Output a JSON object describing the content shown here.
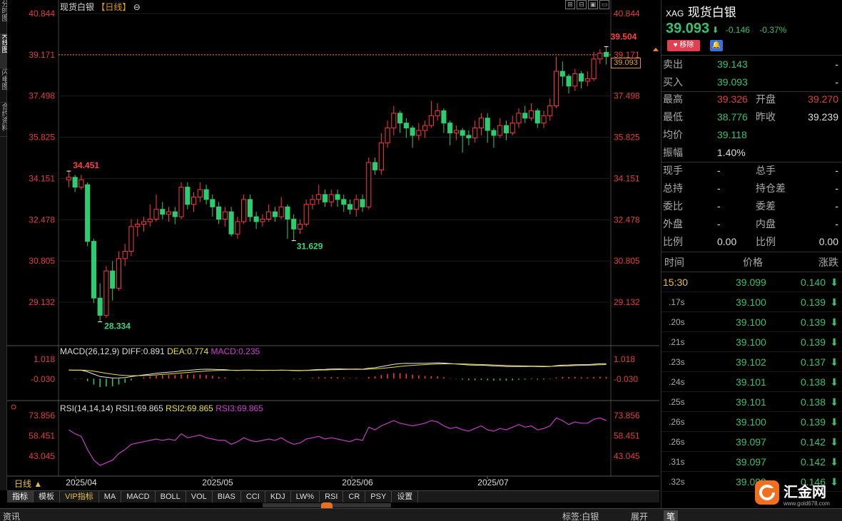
{
  "left_tabs": [
    {
      "label": "分时图",
      "active": false
    },
    {
      "label": "K线图",
      "active": true
    },
    {
      "label": "闪电图",
      "active": false
    },
    {
      "label": "合约资料",
      "active": false
    }
  ],
  "chart_header": {
    "title": "现货白银",
    "period_label": "【日线】",
    "settings_glyph": "⊖"
  },
  "window_icons": [
    "⊞",
    "⊟",
    "▣",
    "▭"
  ],
  "chart_data": {
    "type": "candlestick",
    "y_ticks": [
      "40.844",
      "39.171",
      "37.498",
      "35.825",
      "34.151",
      "32.478",
      "30.805",
      "29.132"
    ],
    "ylim": [
      28.0,
      41.2
    ],
    "x_ticks": [
      "2025/04",
      "2025/05",
      "2025/06",
      "2025/07"
    ],
    "current_price_line": 39.171,
    "current_price_box": "39.093",
    "annotations": [
      {
        "label": "34.451",
        "color": "#ff4040"
      },
      {
        "label": "28.334",
        "color": "#40d080"
      },
      {
        "label": "31.629",
        "color": "#40d080"
      },
      {
        "label": "39.504",
        "color": "#ff4040"
      }
    ],
    "candles": [
      [
        34.1,
        34.2,
        34.45,
        33.8
      ],
      [
        34.2,
        33.8,
        34.3,
        33.6
      ],
      [
        33.8,
        34.1,
        34.3,
        33.7
      ],
      [
        33.9,
        31.6,
        34.0,
        31.4
      ],
      [
        31.6,
        29.3,
        31.7,
        29.1
      ],
      [
        29.3,
        28.6,
        29.9,
        28.33
      ],
      [
        28.6,
        30.4,
        30.6,
        28.5
      ],
      [
        30.4,
        29.7,
        30.8,
        29.2
      ],
      [
        29.7,
        30.9,
        31.2,
        29.6
      ],
      [
        30.9,
        31.2,
        31.5,
        30.6
      ],
      [
        31.2,
        32.2,
        32.5,
        31.0
      ],
      [
        32.2,
        32.3,
        32.5,
        31.8
      ],
      [
        32.3,
        32.4,
        32.6,
        32.0
      ],
      [
        32.4,
        32.5,
        33.1,
        32.2
      ],
      [
        32.5,
        32.9,
        33.5,
        32.4
      ],
      [
        32.9,
        32.7,
        33.2,
        32.5
      ],
      [
        32.7,
        32.8,
        33.0,
        32.4
      ],
      [
        32.8,
        32.6,
        33.0,
        32.3
      ],
      [
        32.6,
        33.8,
        34.0,
        32.5
      ],
      [
        33.8,
        33.1,
        34.0,
        32.9
      ],
      [
        33.1,
        33.4,
        33.6,
        32.8
      ],
      [
        33.4,
        33.7,
        34.0,
        33.2
      ],
      [
        33.7,
        33.3,
        33.9,
        33.1
      ],
      [
        33.3,
        33.0,
        33.5,
        32.6
      ],
      [
        33.0,
        32.5,
        33.2,
        32.3
      ],
      [
        32.5,
        32.8,
        33.0,
        32.2
      ],
      [
        32.8,
        31.9,
        33.0,
        31.8
      ],
      [
        31.9,
        32.4,
        32.6,
        31.7
      ],
      [
        32.4,
        33.3,
        33.5,
        32.3
      ],
      [
        33.3,
        32.6,
        33.5,
        32.4
      ],
      [
        32.6,
        32.4,
        32.8,
        32.1
      ],
      [
        32.4,
        32.5,
        32.7,
        32.2
      ],
      [
        32.5,
        32.8,
        33.1,
        32.4
      ],
      [
        32.8,
        32.6,
        33.0,
        32.4
      ],
      [
        32.6,
        33.0,
        33.4,
        32.5
      ],
      [
        33.0,
        32.5,
        33.1,
        31.7
      ],
      [
        32.5,
        32.1,
        32.7,
        31.63
      ],
      [
        32.1,
        32.3,
        32.5,
        31.9
      ],
      [
        32.3,
        33.1,
        33.3,
        32.2
      ],
      [
        33.1,
        33.3,
        33.5,
        32.9
      ],
      [
        33.3,
        33.5,
        33.9,
        33.1
      ],
      [
        33.5,
        33.2,
        33.7,
        33.0
      ],
      [
        33.2,
        33.5,
        33.7,
        33.0
      ],
      [
        33.5,
        33.3,
        33.7,
        33.0
      ],
      [
        33.3,
        33.1,
        33.5,
        32.8
      ],
      [
        33.1,
        32.9,
        33.3,
        32.7
      ],
      [
        32.9,
        33.3,
        33.5,
        32.6
      ],
      [
        33.3,
        33.0,
        33.5,
        32.8
      ],
      [
        33.0,
        34.8,
        35.0,
        32.9
      ],
      [
        34.8,
        34.5,
        35.0,
        34.3
      ],
      [
        34.5,
        35.6,
        36.0,
        34.3
      ],
      [
        35.6,
        36.2,
        36.5,
        35.4
      ],
      [
        36.2,
        36.8,
        37.1,
        35.9
      ],
      [
        36.8,
        36.4,
        36.9,
        36.0
      ],
      [
        36.4,
        36.2,
        36.6,
        35.8
      ],
      [
        36.2,
        35.9,
        36.3,
        35.4
      ],
      [
        35.9,
        36.1,
        36.4,
        35.7
      ],
      [
        36.1,
        36.3,
        36.5,
        35.8
      ],
      [
        36.3,
        36.7,
        37.3,
        36.2
      ],
      [
        36.7,
        36.9,
        37.2,
        36.5
      ],
      [
        36.9,
        36.4,
        37.0,
        36.0
      ],
      [
        36.4,
        36.0,
        36.5,
        35.5
      ],
      [
        36.0,
        36.1,
        36.3,
        35.7
      ],
      [
        36.1,
        35.9,
        36.2,
        35.2
      ],
      [
        35.9,
        35.8,
        36.1,
        35.5
      ],
      [
        35.8,
        36.2,
        36.5,
        35.6
      ],
      [
        36.2,
        36.6,
        36.8,
        35.9
      ],
      [
        36.6,
        36.1,
        36.8,
        35.6
      ],
      [
        36.1,
        35.9,
        36.2,
        35.4
      ],
      [
        35.9,
        36.3,
        36.6,
        35.8
      ],
      [
        36.3,
        36.0,
        36.5,
        35.7
      ],
      [
        36.0,
        36.4,
        36.7,
        35.9
      ],
      [
        36.4,
        36.8,
        37.0,
        36.2
      ],
      [
        36.8,
        36.6,
        37.1,
        36.4
      ],
      [
        36.6,
        36.9,
        37.2,
        36.5
      ],
      [
        36.9,
        36.4,
        37.0,
        36.2
      ],
      [
        36.4,
        36.7,
        36.9,
        36.2
      ],
      [
        36.7,
        37.1,
        37.4,
        36.5
      ],
      [
        37.1,
        38.5,
        39.1,
        37.0
      ],
      [
        38.5,
        38.3,
        38.9,
        37.9
      ],
      [
        38.3,
        37.9,
        38.4,
        37.6
      ],
      [
        37.9,
        38.4,
        38.6,
        37.7
      ],
      [
        38.4,
        38.1,
        38.5,
        37.8
      ],
      [
        38.1,
        38.2,
        38.5,
        37.9
      ],
      [
        38.2,
        39.0,
        39.3,
        38.1
      ],
      [
        39.0,
        39.24,
        39.4,
        38.8
      ],
      [
        39.27,
        39.1,
        39.5,
        38.78
      ]
    ]
  },
  "macd": {
    "legend_title": "MACD(26,12,9)",
    "diff_label": "DIFF:0.891",
    "dea_label": "DEA:0.774",
    "macd_label": "MACD:0.235",
    "y_ticks": [
      "1.018",
      "-0.030"
    ]
  },
  "rsi": {
    "legend_title": "RSI(14,14,14)",
    "rsi1_label": "RSI1:69.865",
    "rsi2_label": "RSI2:69.865",
    "rsi3_label": "RSI3:69.865",
    "y_ticks": [
      "73.856",
      "58.451",
      "43.045"
    ],
    "values": [
      63,
      60,
      58,
      48,
      40,
      36,
      38,
      40,
      45,
      48,
      52,
      53,
      54,
      55,
      56,
      55,
      56,
      55,
      60,
      57,
      58,
      59,
      57,
      56,
      55,
      55,
      52,
      54,
      57,
      55,
      54,
      55,
      56,
      55,
      57,
      54,
      52,
      53,
      56,
      57,
      58,
      56,
      57,
      56,
      55,
      54,
      56,
      55,
      65,
      63,
      66,
      68,
      70,
      68,
      67,
      66,
      67,
      68,
      70,
      69,
      66,
      64,
      65,
      63,
      62,
      64,
      66,
      63,
      62,
      64,
      63,
      65,
      67,
      65,
      66,
      63,
      64,
      66,
      72,
      70,
      67,
      69,
      68,
      68,
      71,
      72,
      70
    ],
    "color": "#c040c0"
  },
  "period": "日线 ▲",
  "bottom_tabs": [
    {
      "label": "指标",
      "active": true,
      "vip": false
    },
    {
      "label": "模板",
      "active": false,
      "vip": false
    },
    {
      "label": "VIP指标",
      "active": false,
      "vip": true
    },
    {
      "label": "MA",
      "active": false,
      "vip": false
    },
    {
      "label": "MACD",
      "active": false,
      "vip": false
    },
    {
      "label": "BOLL",
      "active": false,
      "vip": false
    },
    {
      "label": "VOL",
      "active": false,
      "vip": false
    },
    {
      "label": "BIAS",
      "active": false,
      "vip": false
    },
    {
      "label": "CCI",
      "active": false,
      "vip": false
    },
    {
      "label": "KDJ",
      "active": false,
      "vip": false
    },
    {
      "label": "LW%",
      "active": false,
      "vip": false
    },
    {
      "label": "RSI",
      "active": false,
      "vip": false
    },
    {
      "label": "CR",
      "active": false,
      "vip": false
    },
    {
      "label": "PSY",
      "active": false,
      "vip": false
    },
    {
      "label": "设置",
      "active": false,
      "vip": false
    }
  ],
  "status_bar": {
    "left": "资讯",
    "tag": "标签:白银",
    "expand": "展开",
    "pen": "笔"
  },
  "quote": {
    "code": "XAG",
    "name": "现货白银",
    "price": "39.093",
    "arrow": "⬇",
    "change": "-0.146",
    "change_pct": "-0.37%",
    "remove_label": "移除",
    "rows": [
      {
        "l1": "卖出",
        "v1": "39.143",
        "c1": "grn",
        "l2": "",
        "v2": "-",
        "c2": "wht"
      },
      {
        "l1": "买入",
        "v1": "39.093",
        "c1": "grn",
        "l2": "",
        "v2": "-",
        "c2": "wht"
      },
      {
        "l1": "最高",
        "v1": "39.326",
        "c1": "red",
        "l2": "开盘",
        "v2": "39.270",
        "c2": "red"
      },
      {
        "l1": "最低",
        "v1": "38.776",
        "c1": "grn",
        "l2": "昨收",
        "v2": "39.239",
        "c2": "wht"
      },
      {
        "l1": "均价",
        "v1": "39.118",
        "c1": "grn",
        "l2": "",
        "v2": "",
        "c2": "wht"
      },
      {
        "l1": "振幅",
        "v1": "1.40%",
        "c1": "wht",
        "l2": "",
        "v2": "",
        "c2": "wht"
      },
      {
        "l1": "现手",
        "v1": "-",
        "c1": "wht",
        "l2": "总手",
        "v2": "-",
        "c2": "wht"
      },
      {
        "l1": "总持",
        "v1": "-",
        "c1": "wht",
        "l2": "持仓差",
        "v2": "-",
        "c2": "wht"
      },
      {
        "l1": "委比",
        "v1": "-",
        "c1": "wht",
        "l2": "委差",
        "v2": "-",
        "c2": "wht"
      },
      {
        "l1": "外盘",
        "v1": "-",
        "c1": "wht",
        "l2": "内盘",
        "v2": "-",
        "c2": "wht"
      },
      {
        "l1": "比例",
        "v1": "0.00",
        "c1": "wht",
        "l2": "比例",
        "v2": "0.00",
        "c2": "wht"
      }
    ],
    "ticks_header": {
      "time": "时间",
      "price": "价格",
      "change": "涨跌"
    },
    "ticks": [
      {
        "t": "15:30",
        "p": "39.099",
        "c": "0.140"
      },
      {
        "t": ".17s",
        "p": "39.100",
        "c": "0.139"
      },
      {
        "t": ".20s",
        "p": "39.100",
        "c": "0.139"
      },
      {
        "t": ".21s",
        "p": "39.100",
        "c": "0.139"
      },
      {
        "t": ".23s",
        "p": "39.102",
        "c": "0.137"
      },
      {
        "t": ".24s",
        "p": "39.101",
        "c": "0.138"
      },
      {
        "t": ".25s",
        "p": "39.101",
        "c": "0.138"
      },
      {
        "t": ".26s",
        "p": "39.100",
        "c": "0.139"
      },
      {
        "t": ".26s",
        "p": "39.097",
        "c": "0.142"
      },
      {
        "t": ".31s",
        "p": "39.097",
        "c": "0.142"
      },
      {
        "t": ".32s",
        "p": "39.093",
        "c": "0.146"
      }
    ]
  },
  "logo": {
    "name": "汇金网",
    "url": "www.gold678.com"
  }
}
